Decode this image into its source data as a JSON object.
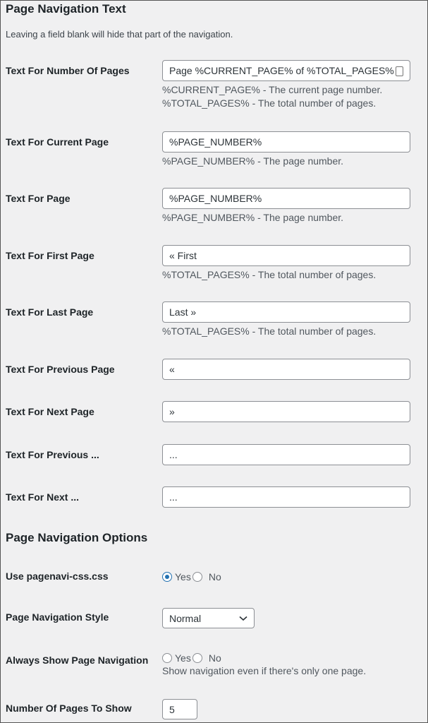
{
  "text_section": {
    "title": "Page Navigation Text",
    "note": "Leaving a field blank will hide that part of the navigation.",
    "fields": [
      {
        "label": "Text For Number Of Pages",
        "value": "Page %CURRENT_PAGE% of %TOTAL_PAGES%",
        "desc": [
          "%CURRENT_PAGE% - The current page number.",
          "%TOTAL_PAGES% - The total number of pages."
        ]
      },
      {
        "label": "Text For Current Page",
        "value": "%PAGE_NUMBER%",
        "desc": [
          "%PAGE_NUMBER% - The page number."
        ]
      },
      {
        "label": "Text For Page",
        "value": "%PAGE_NUMBER%",
        "desc": [
          "%PAGE_NUMBER% - The page number."
        ]
      },
      {
        "label": "Text For First Page",
        "value": "« First",
        "desc": [
          "%TOTAL_PAGES% - The total number of pages."
        ]
      },
      {
        "label": "Text For Last Page",
        "value": "Last »",
        "desc": [
          "%TOTAL_PAGES% - The total number of pages."
        ]
      },
      {
        "label": "Text For Previous Page",
        "value": "«"
      },
      {
        "label": "Text For Next Page",
        "value": "»"
      },
      {
        "label": "Text For Previous ...",
        "value": "..."
      },
      {
        "label": "Text For Next ...",
        "value": "..."
      }
    ]
  },
  "options_section": {
    "title": "Page Navigation Options",
    "use_css": {
      "label": "Use pagenavi-css.css",
      "yes": "Yes",
      "no": "No",
      "selected": "Yes"
    },
    "style": {
      "label": "Page Navigation Style",
      "value": "Normal"
    },
    "always_show": {
      "label": "Always Show Page Navigation",
      "yes": "Yes",
      "no": "No",
      "selected": null,
      "desc": "Show navigation even if there's only one page."
    },
    "num_pages": {
      "label": "Number Of Pages To Show",
      "value": "5"
    }
  },
  "colors": {
    "accent": "#2271b1",
    "background": "#f0f0f1"
  }
}
